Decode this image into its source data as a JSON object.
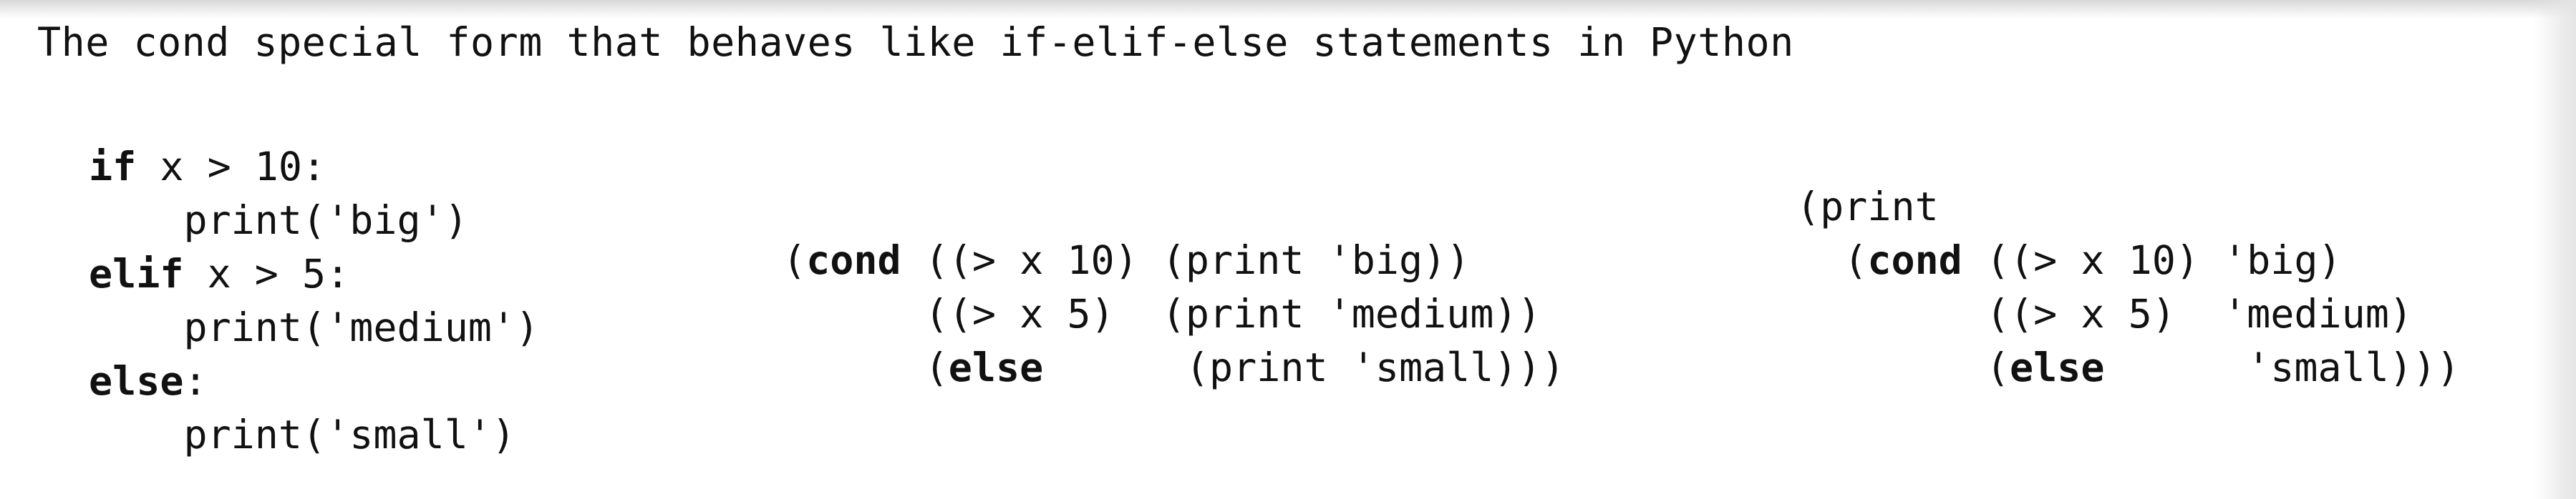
{
  "title": "The cond special form that behaves like if-elif-else statements in Python",
  "python": {
    "if_kw": "if",
    "if_cond": " x > 10:",
    "print_big": "    print('big')",
    "elif_kw": "elif",
    "elif_cond": " x > 5:",
    "print_medium": "    print('medium')",
    "else_kw": "else",
    "else_colon": ":",
    "print_small": "    print('small')"
  },
  "scheme_cond": {
    "open": "(",
    "cond_kw": "cond",
    "clause1": " ((> x 10) (print 'big))",
    "clause2": "      ((> x 5)  (print 'medium))",
    "clause3_open": "      (",
    "else_kw": "else",
    "clause3_rest": "      (print 'small)))"
  },
  "scheme_print_cond": {
    "line1": "(print",
    "open": "  (",
    "cond_kw": "cond",
    "clause1": " ((> x 10) 'big)",
    "clause2": "        ((> x 5)  'medium)",
    "clause3_open": "        (",
    "else_kw": "else",
    "clause3_rest": "      'small)))"
  }
}
